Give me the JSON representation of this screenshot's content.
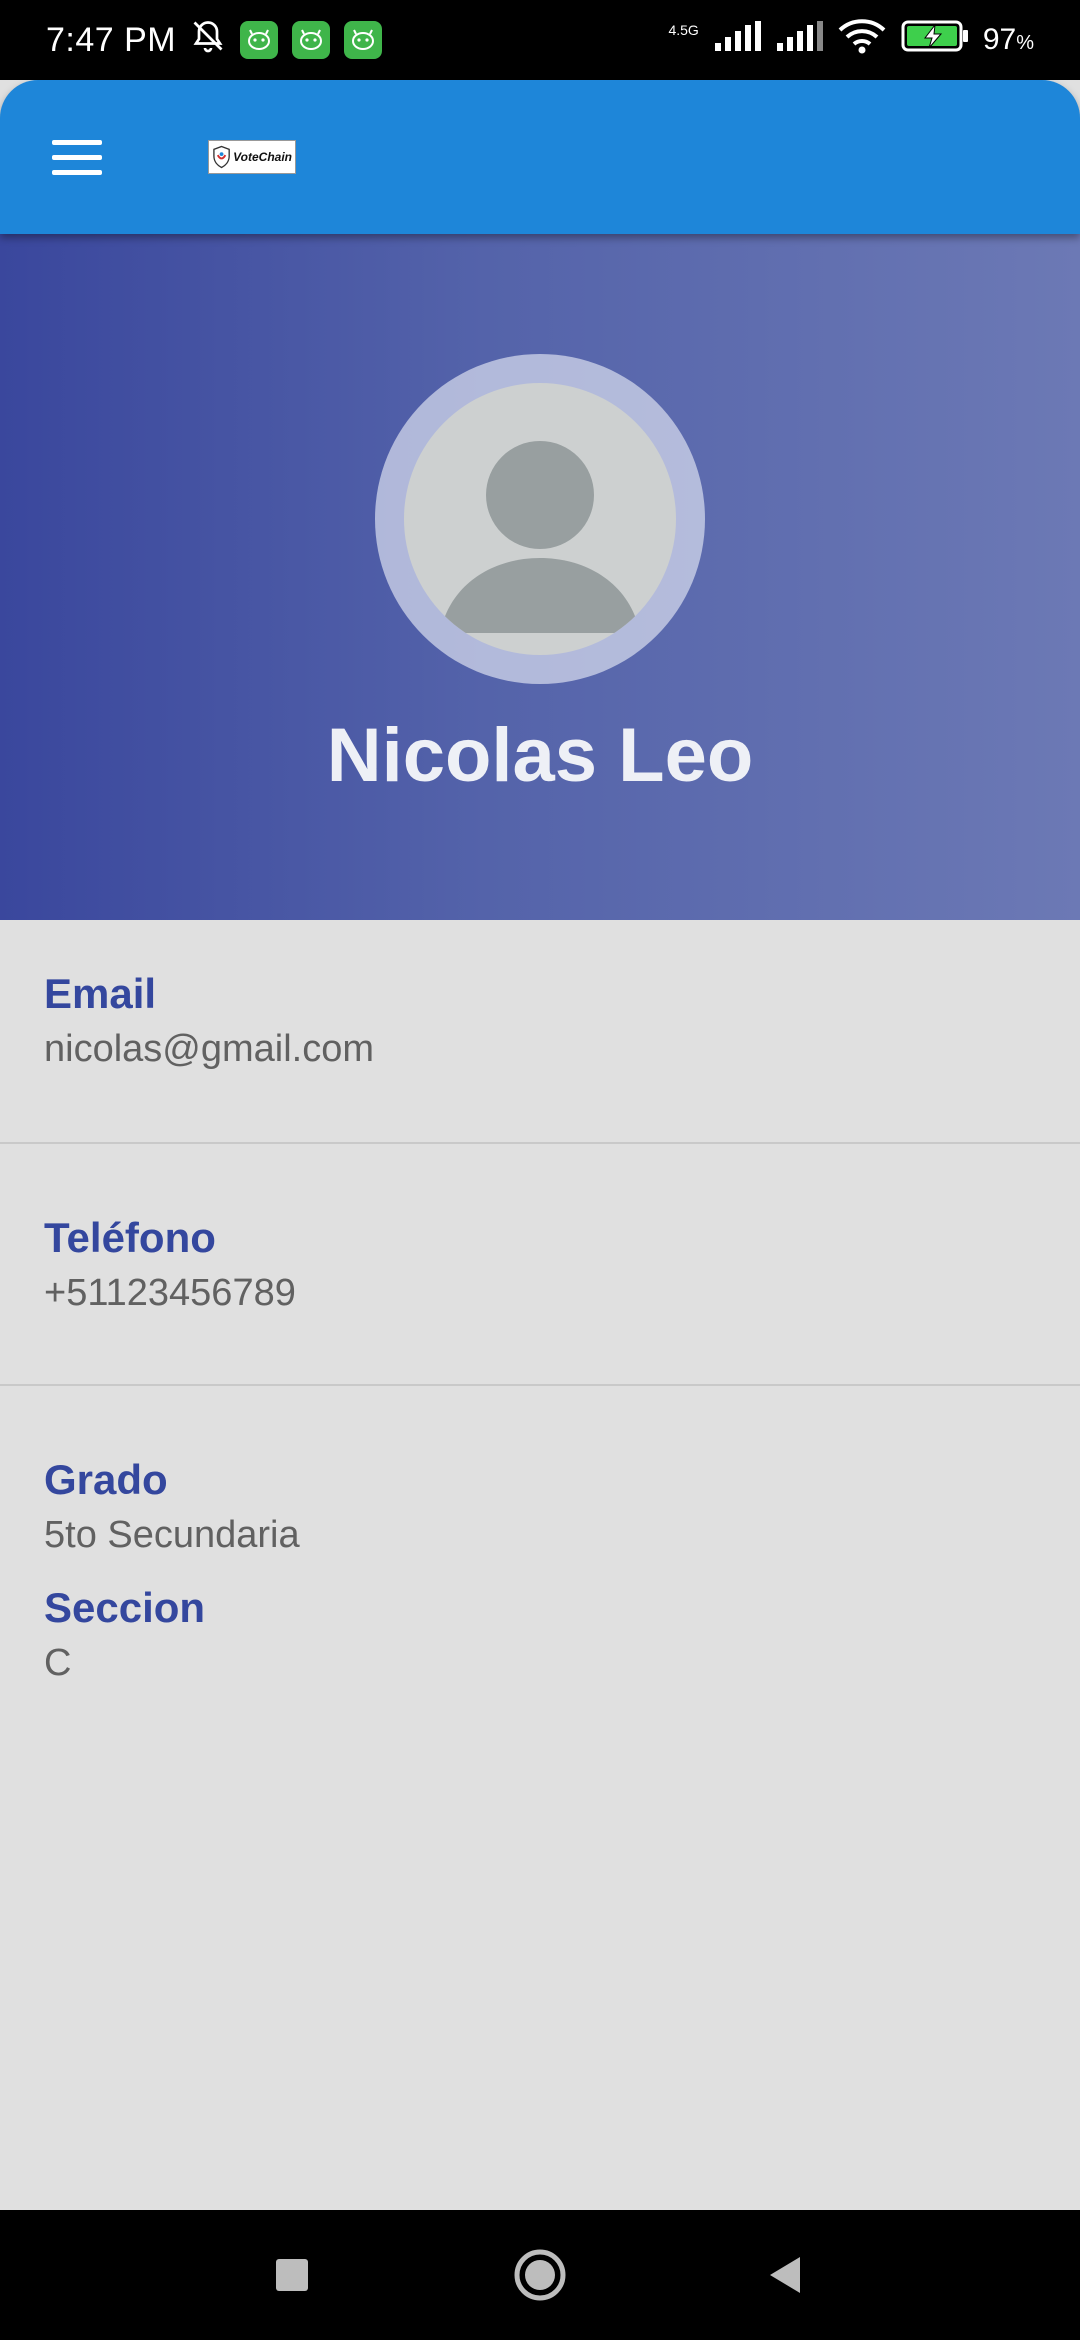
{
  "status_bar": {
    "time": "7:47 PM",
    "network": "4.5G",
    "battery": "97",
    "battery_unit": "%",
    "notif_icons": [
      "silent-bell-icon",
      "app-notification-icon",
      "app-notification-icon",
      "app-notification-icon"
    ]
  },
  "app_bar": {
    "color": "#1e86d9",
    "logo_text": "VoteChain"
  },
  "profile": {
    "name": "Nicolas Leo"
  },
  "fields": [
    {
      "label": "Email",
      "value": "nicolas@gmail.com"
    },
    {
      "label": "Teléfono",
      "value": "+51123456789"
    },
    {
      "label": "Grado",
      "value": "5to Secundaria"
    },
    {
      "label": "Seccion",
      "value": "C"
    }
  ],
  "colors": {
    "label": "#34479e",
    "value": "#616161",
    "header_gradient_start": "#3a479d",
    "header_gradient_end": "#6c79b5"
  }
}
